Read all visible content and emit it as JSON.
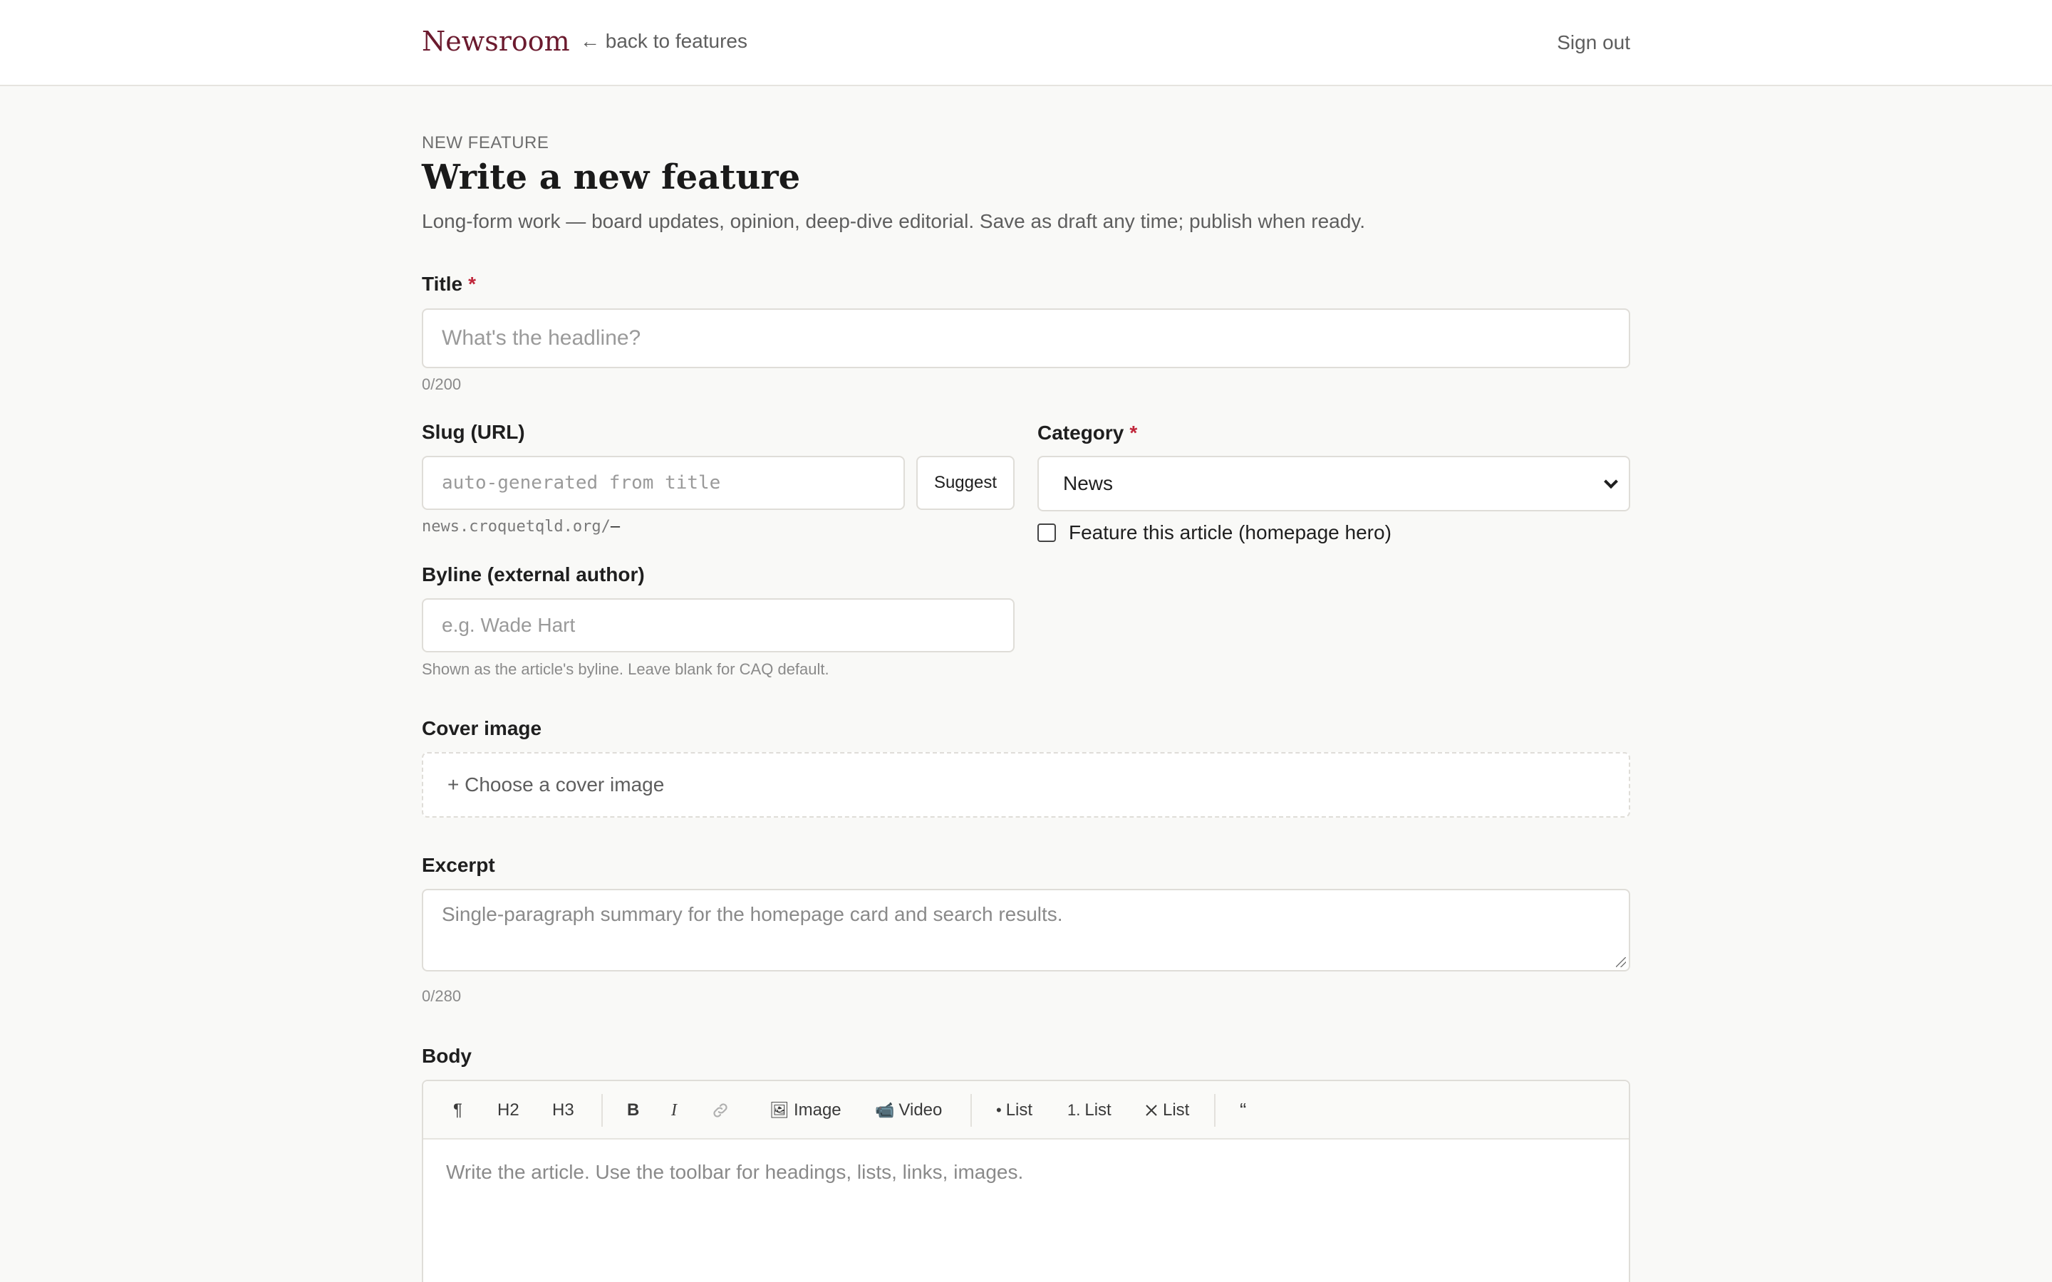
{
  "header": {
    "brand": "Newsroom",
    "back_link": "← back to features",
    "sign_out": "Sign out"
  },
  "page": {
    "eyebrow": "NEW FEATURE",
    "title": "Write a new feature",
    "subtitle": "Long-form work — board updates, opinion, deep-dive editorial. Save as draft any time; publish when ready."
  },
  "form": {
    "title": {
      "label": "Title",
      "required_mark": "*",
      "placeholder": "What's the headline?",
      "counter": "0/200"
    },
    "slug": {
      "label": "Slug (URL)",
      "placeholder": "auto-generated from title",
      "suggest_label": "Suggest",
      "url_preview": "news.croquetqld.org/",
      "url_suffix": "—"
    },
    "category": {
      "label": "Category",
      "required_mark": "*",
      "selected": "News"
    },
    "byline": {
      "label": "Byline (external author)",
      "placeholder": "e.g. Wade Hart",
      "hint": "Shown as the article's byline. Leave blank for CAQ default."
    },
    "feature": {
      "label": "Feature this article (homepage hero)",
      "checked": false
    },
    "cover": {
      "label": "Cover image",
      "button": "+ Choose a cover image"
    },
    "excerpt": {
      "label": "Excerpt",
      "placeholder": "Single-paragraph summary for the homepage card and search results.",
      "counter": "0/280"
    },
    "body": {
      "label": "Body",
      "placeholder": "Write the article. Use the toolbar for headings, lists, links, images.",
      "toolbar": {
        "paragraph": "¶",
        "h2": "H2",
        "h3": "H3",
        "bold": "B",
        "italic": "I",
        "image": "Image",
        "video": "Video",
        "bullet_list": "List",
        "bullet_mark": "•",
        "ordered_list": "List",
        "ordered_mark": "1.",
        "clear_list": "List",
        "quote": "“"
      }
    }
  }
}
